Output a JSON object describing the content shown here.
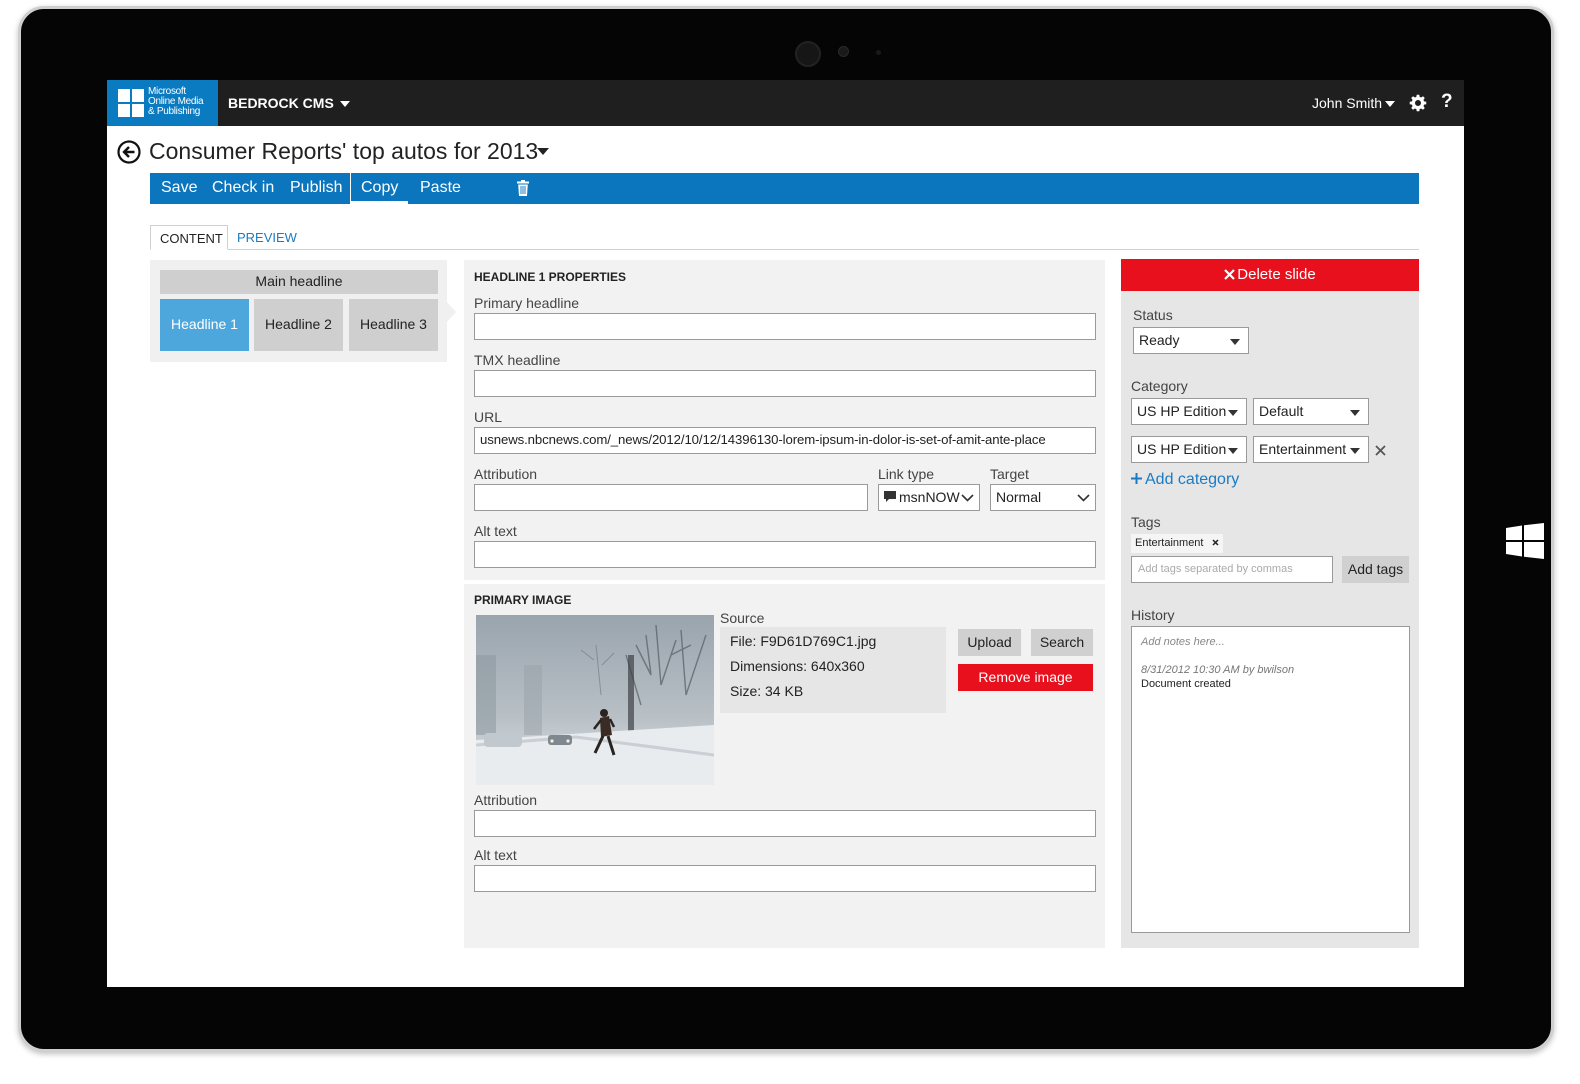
{
  "brand": {
    "line1": "Microsoft",
    "line2": "Online Media",
    "line3": "& Publishing",
    "color": "#0a7bc1"
  },
  "app": {
    "name": "BEDROCK CMS"
  },
  "user": {
    "name": "John Smith"
  },
  "help_label": "?",
  "document": {
    "title": "Consumer Reports' top autos for 2013"
  },
  "actions": {
    "save": "Save",
    "check_in": "Check in",
    "publish": "Publish",
    "copy": "Copy",
    "paste": "Paste"
  },
  "tabs": {
    "content": "CONTENT",
    "preview": "PREVIEW"
  },
  "slides": {
    "main": "Main headline",
    "headlines": [
      "Headline 1",
      "Headline 2",
      "Headline 3"
    ],
    "active_index": 0
  },
  "headline_props": {
    "section_title": "HEADLINE 1 PROPERTIES",
    "primary_headline_label": "Primary headline",
    "primary_headline_value": "",
    "tmx_headline_label": "TMX headline",
    "tmx_headline_value": "",
    "url_label": "URL",
    "url_value": "usnews.nbcnews.com/_news/2012/10/12/14396130-lorem-ipsum-in-dolor-is-set-of-amit-ante-place",
    "attribution_label": "Attribution",
    "attribution_value": "",
    "link_type_label": "Link type",
    "link_type_value": "msnNOW",
    "target_label": "Target",
    "target_value": "Normal",
    "alt_text_label": "Alt text",
    "alt_text_value": ""
  },
  "primary_image": {
    "section_title": "PRIMARY IMAGE",
    "source_label": "Source",
    "file": "File: F9D61D769C1.jpg",
    "dimensions": "Dimensions: 640x360",
    "size": "Size: 34 KB",
    "upload": "Upload",
    "search": "Search",
    "remove": "Remove image",
    "attribution_label": "Attribution",
    "alt_text_label": "Alt text"
  },
  "sidebar": {
    "delete_slide": "Delete slide",
    "status_label": "Status",
    "status_value": "Ready",
    "category_label": "Category",
    "categories": [
      {
        "edition": "US HP Edition",
        "section": "Default"
      },
      {
        "edition": "US HP Edition",
        "section": "Entertainment"
      }
    ],
    "add_category": "Add category",
    "tags_label": "Tags",
    "tags": [
      "Entertainment"
    ],
    "tags_placeholder": "Add tags separated by commas",
    "add_tags": "Add tags",
    "history_label": "History",
    "history_placeholder": "Add notes here...",
    "history_meta": "8/31/2012  10:30 AM by bwilson",
    "history_entry": "Document created"
  },
  "colors": {
    "accent": "#0b75bd",
    "danger": "#e8101d",
    "active_slide": "#4ea7dc"
  }
}
